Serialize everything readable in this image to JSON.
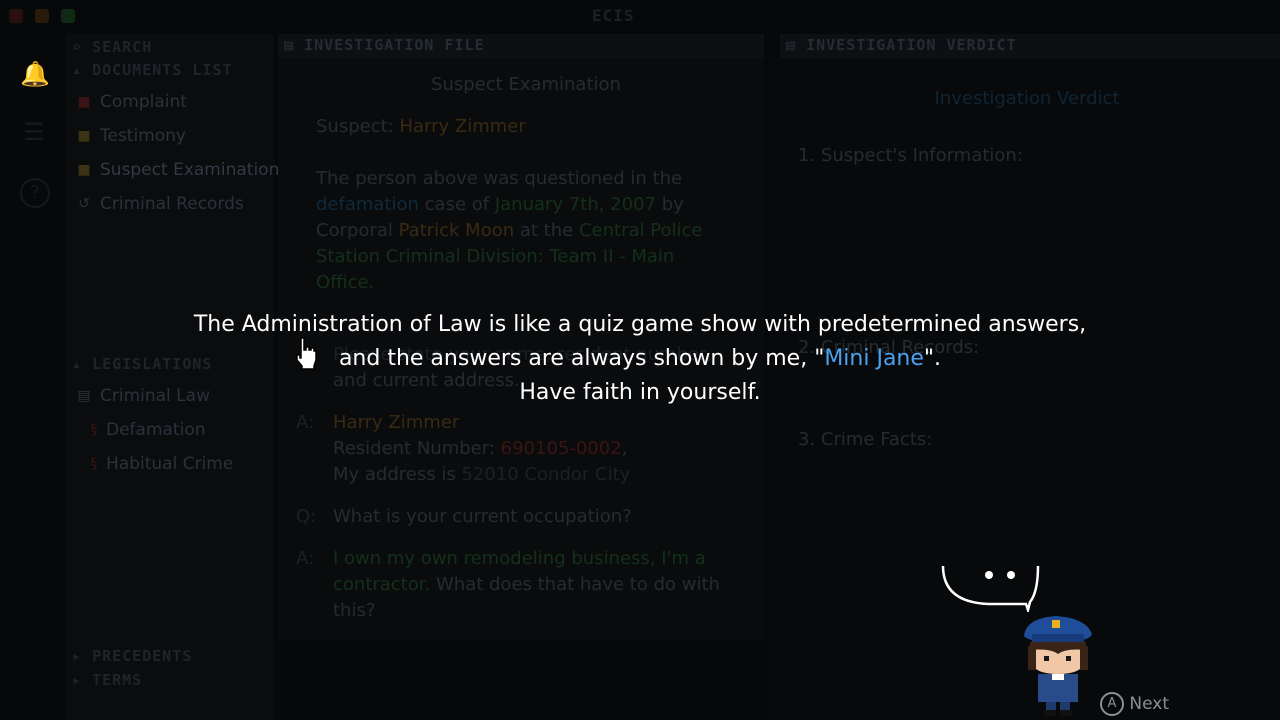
{
  "window": {
    "logo_text": "ECIS"
  },
  "left_icons": [
    "bell-icon",
    "sliders-icon",
    "help-icon"
  ],
  "sidebar": {
    "search_label": "SEARCH",
    "documents_title": "DOCUMENTS LIST",
    "documents": [
      {
        "label": "Complaint",
        "icon": "complaint-icon"
      },
      {
        "label": "Testimony",
        "icon": "testimony-icon"
      },
      {
        "label": "Suspect Examination",
        "icon": "examination-icon"
      },
      {
        "label": "Criminal Records",
        "icon": "records-icon"
      }
    ],
    "legislations_title": "LEGISLATIONS",
    "legislations": [
      {
        "label": "Criminal Law",
        "icon": "folder-icon"
      },
      {
        "label": "Defamation",
        "icon": "law-icon"
      },
      {
        "label": "Habitual Crime",
        "icon": "law-icon"
      }
    ],
    "precedents_title": "PRECEDENTS",
    "terms_title": "TERMS"
  },
  "file_panel": {
    "header": "INVESTIGATION FILE",
    "doc_title": "Suspect Examination",
    "suspect_label": "Suspect:",
    "suspect_name": "Harry Zimmer",
    "intro": {
      "t1": "The person above was questioned in the",
      "case": "defamation",
      "t2": "case of",
      "date": "January 7th, 2007",
      "t3": "by",
      "t4": "Corporal",
      "officer": "Patrick Moon",
      "t5": "at the",
      "station1": "Central Police",
      "station2": "Station Criminal Division: Team II - Main",
      "station3": "Office."
    },
    "q1_partial": "Please state your name, resident number,",
    "q1_line2": "and current address.",
    "a1": {
      "marker": "A:",
      "name": "Harry Zimmer",
      "resident_label": "Resident Number:",
      "resident_number": "690105-0002",
      "comma": ",",
      "address_label": "My address is",
      "address": "52010 Condor City"
    },
    "q2": {
      "marker": "Q:",
      "text": "What is your current occupation?"
    },
    "a2": {
      "marker": "A:",
      "green1": "I own my own remodeling business, I'm a",
      "green2": "contractor.",
      "rest2": "What does that have to do with",
      "rest3": "this?"
    }
  },
  "verdict_panel": {
    "header": "INVESTIGATION VERDICT",
    "title": "Investigation Verdict",
    "sections": [
      "1. Suspect's Information:",
      "2. Criminal Records:",
      "3. Crime Facts:"
    ]
  },
  "dialog": {
    "line1": "The Administration of Law is like a quiz game show with predetermined answers,",
    "line2_pre": "and the answers are always shown by me, \"",
    "line2_name": "Mini Jane",
    "line2_post": "\".",
    "line3": "Have faith in yourself."
  },
  "footer": {
    "button_glyph": "A",
    "next_label": "Next"
  },
  "colors": {
    "highlight": "#4aa3f0",
    "dialog_text": "#ffffff"
  }
}
